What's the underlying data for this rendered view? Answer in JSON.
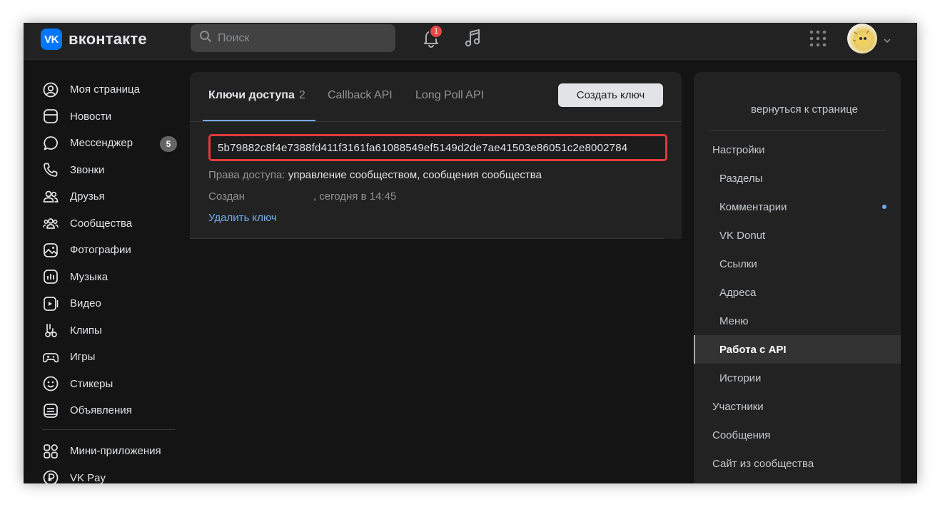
{
  "header": {
    "logo_mark": "VK",
    "logo_text": "вконтакте",
    "search_placeholder": "Поиск",
    "notification_count": "1"
  },
  "left_nav": {
    "items": [
      {
        "label": "Моя страница",
        "icon": "user-circle-icon"
      },
      {
        "label": "Новости",
        "icon": "newspaper-icon"
      },
      {
        "label": "Мессенджер",
        "icon": "chat-bubble-icon",
        "badge": "5"
      },
      {
        "label": "Звонки",
        "icon": "phone-icon"
      },
      {
        "label": "Друзья",
        "icon": "friends-icon"
      },
      {
        "label": "Сообщества",
        "icon": "communities-icon"
      },
      {
        "label": "Фотографии",
        "icon": "photo-icon"
      },
      {
        "label": "Музыка",
        "icon": "music-icon"
      },
      {
        "label": "Видео",
        "icon": "video-icon"
      },
      {
        "label": "Клипы",
        "icon": "clips-icon"
      },
      {
        "label": "Игры",
        "icon": "gamepad-icon"
      },
      {
        "label": "Стикеры",
        "icon": "smile-icon"
      },
      {
        "label": "Объявления",
        "icon": "classifieds-icon"
      }
    ],
    "extra_items": [
      {
        "label": "Мини-приложения",
        "icon": "mini-apps-icon"
      },
      {
        "label": "VK Pay",
        "icon": "vk-pay-icon"
      }
    ]
  },
  "main": {
    "tabs": [
      {
        "label": "Ключи доступа",
        "count": "2"
      },
      {
        "label": "Callback API"
      },
      {
        "label": "Long Poll API"
      }
    ],
    "create_key_label": "Создать ключ",
    "key_value": "5b79882c8f4e7388fd411f3161fa61088549ef5149d2de7ae41503e86051c2e8002784",
    "permissions_label": "Права доступа:",
    "permissions_value": "управление сообществом, сообщения сообщества",
    "created_label": "Создан",
    "created_value": ", сегодня в 14:45",
    "delete_key_label": "Удалить ключ"
  },
  "right_nav": {
    "back_label": "вернуться к странице",
    "items": [
      {
        "label": "Настройки",
        "level": 0
      },
      {
        "label": "Разделы",
        "level": 1
      },
      {
        "label": "Комментарии",
        "level": 1,
        "dot": true
      },
      {
        "label": "VK Donut",
        "level": 1
      },
      {
        "label": "Ссылки",
        "level": 1
      },
      {
        "label": "Адреса",
        "level": 1
      },
      {
        "label": "Меню",
        "level": 1
      },
      {
        "label": "Работа с API",
        "level": 1,
        "active": true
      },
      {
        "label": "Истории",
        "level": 1
      },
      {
        "label": "Участники",
        "level": 0
      },
      {
        "label": "Сообщения",
        "level": 0
      },
      {
        "label": "Сайт из сообщества",
        "level": 0
      }
    ]
  },
  "colors": {
    "background": "#141414",
    "panel": "#222222",
    "accent": "#71aaeb",
    "vk_blue": "#0077ff",
    "highlight_border": "#e03a3a",
    "notification_badge": "#e64646"
  }
}
